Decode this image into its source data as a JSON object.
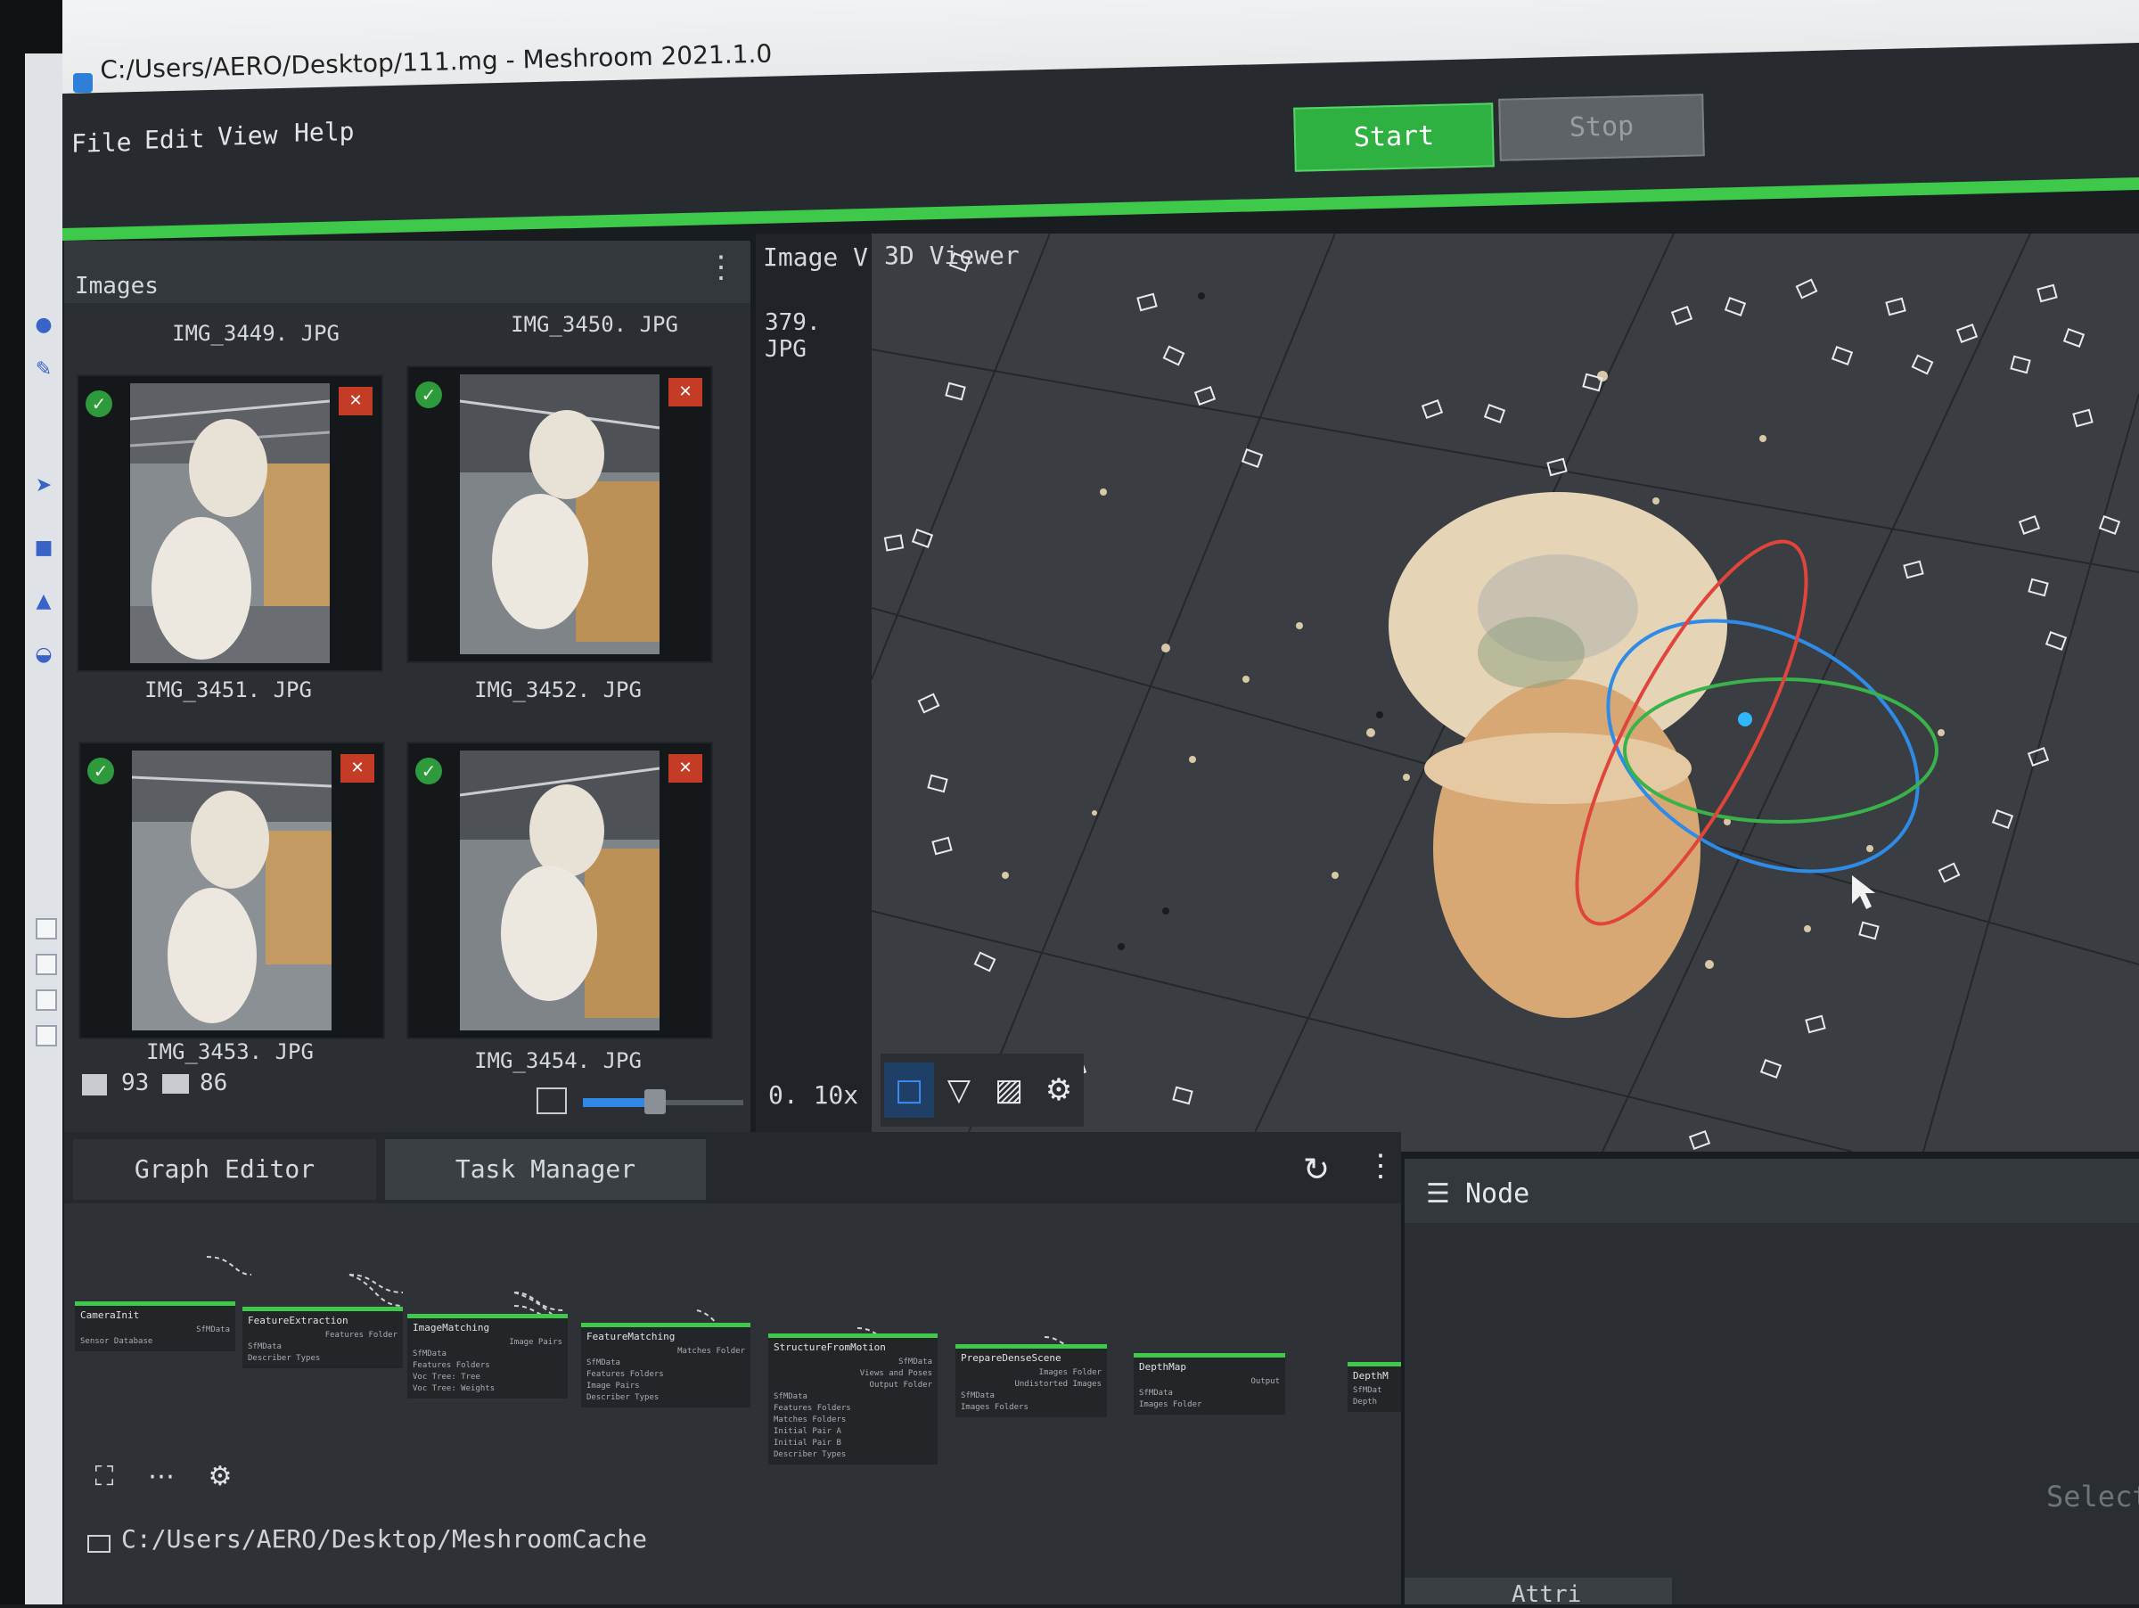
{
  "window": {
    "title": "C:/Users/AERO/Desktop/111.mg - Meshroom 2021.1.0"
  },
  "menu": {
    "items": [
      "File",
      "Edit",
      "View",
      "Help"
    ]
  },
  "toolbar": {
    "start_label": "Start",
    "stop_label": "Stop"
  },
  "images_panel": {
    "title": "Images",
    "top_captions": [
      "IMG_3449. JPG",
      "IMG_3450. JPG"
    ],
    "thumbnails": [
      {
        "caption": "IMG_3451. JPG"
      },
      {
        "caption": "IMG_3452. JPG"
      },
      {
        "caption": "IMG_3453. JPG"
      },
      {
        "caption": "IMG_3454. JPG"
      }
    ],
    "image_count": "93",
    "camera_count": "86",
    "thumbnail_size_fraction": 0.45
  },
  "image_viewer": {
    "tab_label": "Image V",
    "current_file": "379. JPG",
    "zoom": "0. 10x"
  },
  "viewer_3d": {
    "tab_label": "3D Viewer",
    "toolbar_icons": [
      "square-icon",
      "triangle-icon",
      "texture-icon",
      "settings-icon"
    ]
  },
  "graph_editor": {
    "tabs": [
      "Graph Editor",
      "Task Manager"
    ],
    "nodes": [
      {
        "title": "CameraInit",
        "attrs": [
          "SfMData",
          "Sensor Database"
        ]
      },
      {
        "title": "FeatureExtraction",
        "attrs": [
          "Features Folder",
          "SfMData",
          "Describer Types"
        ]
      },
      {
        "title": "ImageMatching",
        "attrs": [
          "Image Pairs",
          "SfMData",
          "Features Folders",
          "Voc Tree: Tree",
          "Voc Tree: Weights"
        ]
      },
      {
        "title": "FeatureMatching",
        "attrs": [
          "Matches Folder",
          "SfMData",
          "Features Folders",
          "Image Pairs",
          "Describer Types"
        ]
      },
      {
        "title": "StructureFromMotion",
        "attrs": [
          "SfMData",
          "Views and Poses",
          "Output Folder",
          "SfMData",
          "Features Folders",
          "Matches Folders",
          "Initial Pair A",
          "Initial Pair B",
          "Describer Types"
        ]
      },
      {
        "title": "PrepareDenseScene",
        "attrs": [
          "Images Folder",
          "Undistorted Images",
          "SfMData",
          "Images Folders"
        ]
      },
      {
        "title": "DepthMap",
        "attrs": [
          "Output",
          "SfMData",
          "Images Folder"
        ]
      },
      {
        "title": "DepthM",
        "attrs": [
          "SfMDat",
          "Depth"
        ]
      }
    ],
    "cache_path": "C:/Users/AERO/Desktop/MeshroomCache"
  },
  "node_panel": {
    "title": "Node",
    "placeholder": "Select",
    "attributes_tab": "Attri"
  },
  "colors": {
    "accent_green": "#3ec94a",
    "start_green": "#2fb142",
    "camera_badge_red": "#c43b26",
    "slider_blue": "#2f88e6"
  }
}
